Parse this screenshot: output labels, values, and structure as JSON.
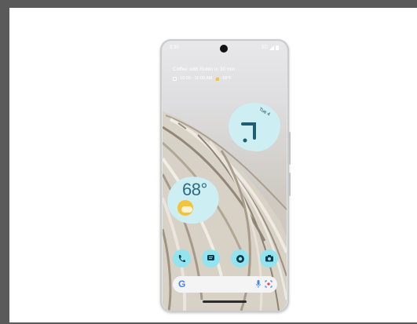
{
  "status": {
    "time": "9:30",
    "network": "5G"
  },
  "glance": {
    "event": "Coffee with Robin in 30 min",
    "details": "10:00 - 11:00 AM",
    "weather": "68°F"
  },
  "clock_widget": {
    "day": "Tue 4"
  },
  "weather_widget": {
    "temperature": "68°"
  },
  "dock": {
    "apps": [
      "phone-icon",
      "messages-icon",
      "chrome-icon",
      "camera-icon"
    ]
  },
  "search_bar": {
    "logo": "G"
  },
  "colors": {
    "widget": "#cdeef2",
    "dock_icon": "#92e4f0",
    "clock_hand": "#1e5e6e",
    "sun": "#f2c33b"
  }
}
